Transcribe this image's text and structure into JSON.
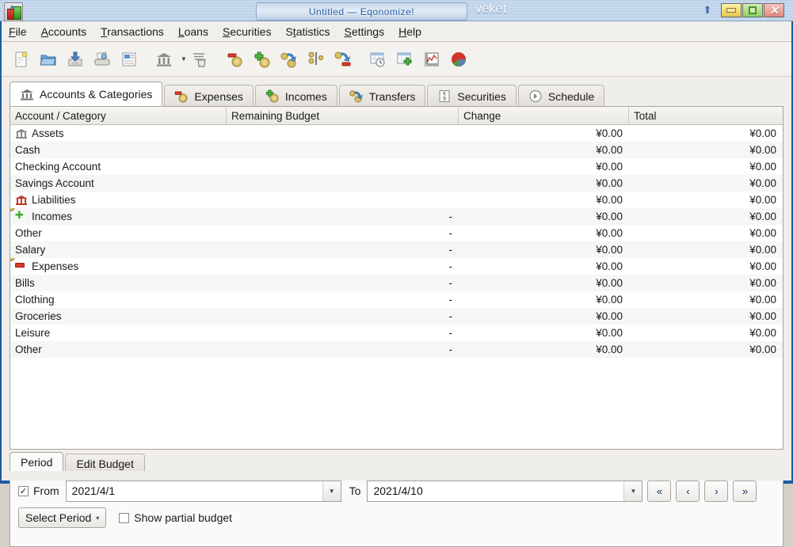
{
  "window": {
    "title": "Untitled — Eqonomize!",
    "desktop_label": "veket",
    "controls": {
      "shade": "shade-button",
      "minimize": "minimize-button",
      "maximize": "maximize-button",
      "close": "close-button",
      "close_glyph": "✕"
    }
  },
  "menubar": [
    {
      "label": "File",
      "mnemonic_index": 0
    },
    {
      "label": "Accounts",
      "mnemonic_index": 0
    },
    {
      "label": "Transactions",
      "mnemonic_index": 0
    },
    {
      "label": "Loans",
      "mnemonic_index": 0
    },
    {
      "label": "Securities",
      "mnemonic_index": 0
    },
    {
      "label": "Statistics",
      "mnemonic_index": 1
    },
    {
      "label": "Settings",
      "mnemonic_index": 0
    },
    {
      "label": "Help",
      "mnemonic_index": 0
    }
  ],
  "toolbar": [
    {
      "name": "new-document-icon"
    },
    {
      "name": "open-folder-icon"
    },
    {
      "name": "save-icon"
    },
    {
      "name": "print-icon"
    },
    {
      "name": "report-icon"
    },
    {
      "name": "new-account-icon"
    },
    {
      "name": "account-dropdown-arrow"
    },
    {
      "name": "delete-account-icon"
    },
    {
      "name": "new-expense-icon"
    },
    {
      "name": "new-income-icon"
    },
    {
      "name": "new-transfer-icon"
    },
    {
      "name": "split-transaction-icon"
    },
    {
      "name": "refund-icon"
    },
    {
      "name": "schedule-icon"
    },
    {
      "name": "new-budget-icon"
    },
    {
      "name": "chart-line-icon"
    },
    {
      "name": "pie-chart-icon"
    }
  ],
  "tabs": [
    {
      "label": "Accounts & Categories",
      "icon": "bank-icon",
      "active": true
    },
    {
      "label": "Expenses",
      "icon": "expense-coin-icon",
      "active": false
    },
    {
      "label": "Incomes",
      "icon": "income-coin-icon",
      "active": false
    },
    {
      "label": "Transfers",
      "icon": "transfer-coin-icon",
      "active": false
    },
    {
      "label": "Securities",
      "icon": "securities-icon",
      "active": false
    },
    {
      "label": "Schedule",
      "icon": "clock-icon",
      "active": false
    }
  ],
  "tree": {
    "columns": [
      "Account / Category",
      "Remaining Budget",
      "Change",
      "Total"
    ],
    "rows": [
      {
        "name": "Assets",
        "icon": "bank-grey",
        "indent": false,
        "remaining": "",
        "change": "¥0.00",
        "total": "¥0.00",
        "alt": false
      },
      {
        "name": "Cash",
        "icon": "",
        "indent": true,
        "remaining": "",
        "change": "¥0.00",
        "total": "¥0.00",
        "alt": true
      },
      {
        "name": "Checking Account",
        "icon": "",
        "indent": true,
        "remaining": "",
        "change": "¥0.00",
        "total": "¥0.00",
        "alt": false
      },
      {
        "name": "Savings Account",
        "icon": "",
        "indent": true,
        "remaining": "",
        "change": "¥0.00",
        "total": "¥0.00",
        "alt": true
      },
      {
        "name": "Liabilities",
        "icon": "bank-red",
        "indent": false,
        "remaining": "",
        "change": "¥0.00",
        "total": "¥0.00",
        "alt": false
      },
      {
        "name": "Incomes",
        "icon": "coin-plus",
        "indent": false,
        "remaining": "-",
        "change": "¥0.00",
        "total": "¥0.00",
        "alt": true
      },
      {
        "name": "Other",
        "icon": "",
        "indent": true,
        "remaining": "-",
        "change": "¥0.00",
        "total": "¥0.00",
        "alt": false
      },
      {
        "name": "Salary",
        "icon": "",
        "indent": true,
        "remaining": "-",
        "change": "¥0.00",
        "total": "¥0.00",
        "alt": true
      },
      {
        "name": "Expenses",
        "icon": "coin-minus",
        "indent": false,
        "remaining": "-",
        "change": "¥0.00",
        "total": "¥0.00",
        "alt": false
      },
      {
        "name": "Bills",
        "icon": "",
        "indent": true,
        "remaining": "-",
        "change": "¥0.00",
        "total": "¥0.00",
        "alt": true
      },
      {
        "name": "Clothing",
        "icon": "",
        "indent": true,
        "remaining": "-",
        "change": "¥0.00",
        "total": "¥0.00",
        "alt": false
      },
      {
        "name": "Groceries",
        "icon": "",
        "indent": true,
        "remaining": "-",
        "change": "¥0.00",
        "total": "¥0.00",
        "alt": true
      },
      {
        "name": "Leisure",
        "icon": "",
        "indent": true,
        "remaining": "-",
        "change": "¥0.00",
        "total": "¥0.00",
        "alt": false
      },
      {
        "name": "Other",
        "icon": "",
        "indent": true,
        "remaining": "-",
        "change": "¥0.00",
        "total": "¥0.00",
        "alt": true
      }
    ]
  },
  "bottom": {
    "tabs": [
      {
        "label": "Period",
        "active": true
      },
      {
        "label": "Edit Budget",
        "active": false
      }
    ],
    "from_checked": true,
    "from_check_glyph": "✓",
    "from_label": "From",
    "from_value": "2021/4/1",
    "to_label": "To",
    "to_value": "2021/4/10",
    "nav": {
      "first": "«",
      "prev": "‹",
      "next": "›",
      "last": "»"
    },
    "select_period_label": "Select Period",
    "select_period_arrow": "▾",
    "show_partial_label": "Show partial budget",
    "show_partial_checked": false
  },
  "colors": {
    "titlebar_blue": "#2a5fa8",
    "frame_blue": "#1d5c9e",
    "accent_green": "#3faa2f",
    "accent_red": "#d83b29",
    "coin_gold": "#c8a83e"
  }
}
